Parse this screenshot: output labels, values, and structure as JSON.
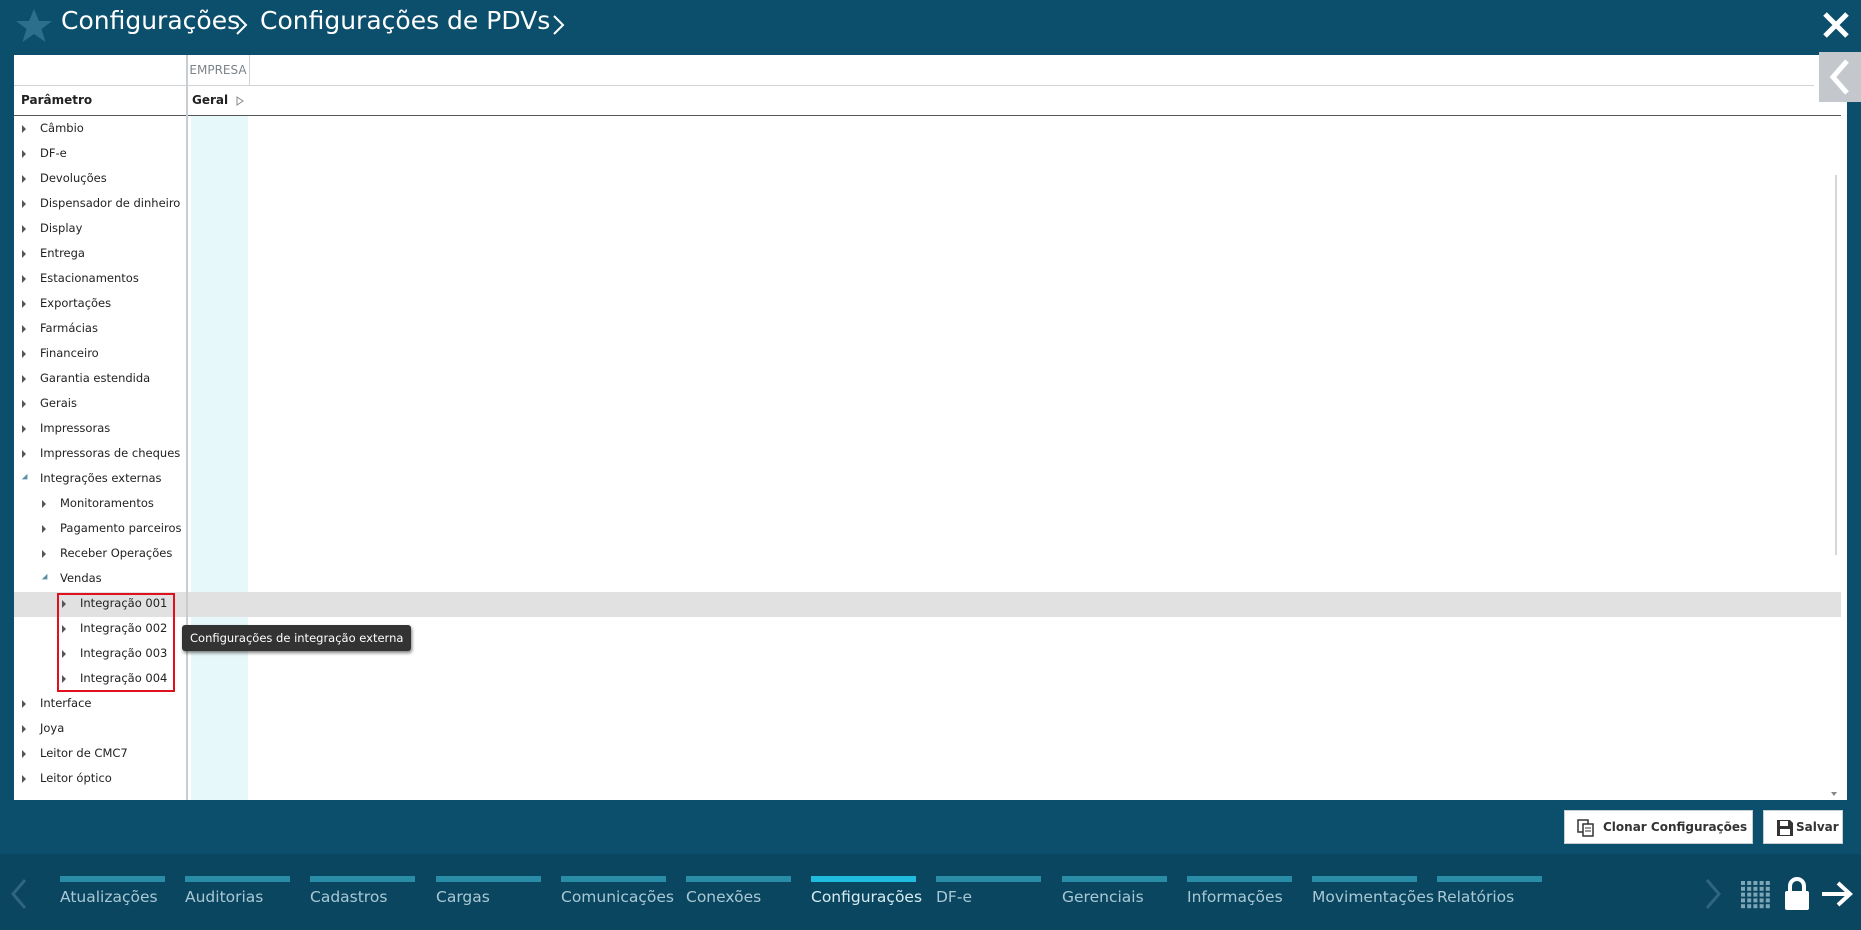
{
  "header": {
    "breadcrumb": [
      "Configurações",
      "Configurações de PDVs"
    ]
  },
  "grid": {
    "group_header": "EMPRESA",
    "param_col_label": "Parâmetro",
    "geral_col_label": "Geral"
  },
  "tree": [
    {
      "label": "Câmbio",
      "level": 0,
      "expanded": false
    },
    {
      "label": "DF-e",
      "level": 0,
      "expanded": false
    },
    {
      "label": "Devoluções",
      "level": 0,
      "expanded": false
    },
    {
      "label": "Dispensador de dinheiro",
      "level": 0,
      "expanded": false
    },
    {
      "label": "Display",
      "level": 0,
      "expanded": false
    },
    {
      "label": "Entrega",
      "level": 0,
      "expanded": false
    },
    {
      "label": "Estacionamentos",
      "level": 0,
      "expanded": false
    },
    {
      "label": "Exportações",
      "level": 0,
      "expanded": false
    },
    {
      "label": "Farmácias",
      "level": 0,
      "expanded": false
    },
    {
      "label": "Financeiro",
      "level": 0,
      "expanded": false
    },
    {
      "label": "Garantia estendida",
      "level": 0,
      "expanded": false
    },
    {
      "label": "Gerais",
      "level": 0,
      "expanded": false
    },
    {
      "label": "Impressoras",
      "level": 0,
      "expanded": false
    },
    {
      "label": "Impressoras de cheques",
      "level": 0,
      "expanded": false
    },
    {
      "label": "Integrações externas",
      "level": 0,
      "expanded": true
    },
    {
      "label": "Monitoramentos",
      "level": 1,
      "expanded": false
    },
    {
      "label": "Pagamento parceiros",
      "level": 1,
      "expanded": false
    },
    {
      "label": "Receber Operações",
      "level": 1,
      "expanded": false
    },
    {
      "label": "Vendas",
      "level": 1,
      "expanded": true
    },
    {
      "label": "Integração 001",
      "level": 2,
      "expanded": false
    },
    {
      "label": "Integração 002",
      "level": 2,
      "expanded": false
    },
    {
      "label": "Integração 003",
      "level": 2,
      "expanded": false
    },
    {
      "label": "Integração 004",
      "level": 2,
      "expanded": false
    },
    {
      "label": "Interface",
      "level": 0,
      "expanded": false
    },
    {
      "label": "Joya",
      "level": 0,
      "expanded": false
    },
    {
      "label": "Leitor de CMC7",
      "level": 0,
      "expanded": false
    },
    {
      "label": "Leitor óptico",
      "level": 0,
      "expanded": false
    }
  ],
  "tooltip": "Configurações de integração externa",
  "actions": {
    "clone_label": "Clonar Configurações",
    "save_label": "Salvar"
  },
  "bottom_nav": {
    "items": [
      "Atualizações",
      "Auditorias",
      "Cadastros",
      "Cargas",
      "Comunicações",
      "Conexões",
      "Configurações",
      "DF-e",
      "Gerenciais",
      "Informações",
      "Movimentações",
      "Relatórios"
    ],
    "active": "Configurações"
  },
  "colors": {
    "header_bg": "#0b4f6c",
    "bottom_bg": "#0a4660",
    "nav_active": "#1fbce0",
    "highlight_border": "#e0101c"
  }
}
